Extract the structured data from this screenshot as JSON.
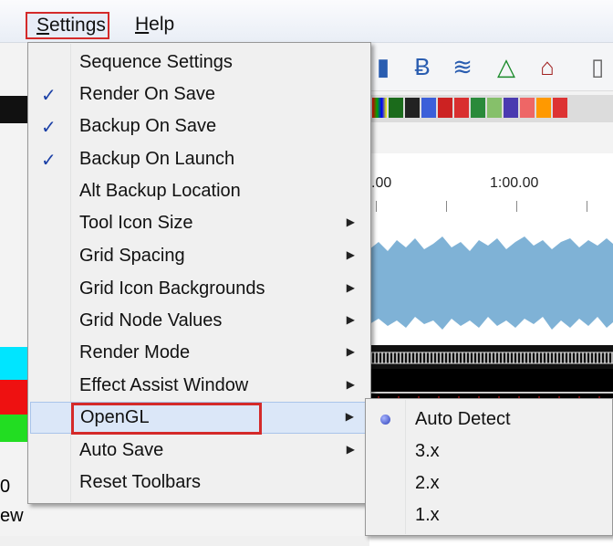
{
  "menubar": {
    "settings": "Settings",
    "help": "Help"
  },
  "background": {
    "ruler": [
      ".00",
      "1:00.00"
    ],
    "left_edge_text": [
      "0",
      "ew"
    ]
  },
  "settings_menu": {
    "items": [
      {
        "label": "Sequence Settings",
        "checked": false,
        "submenu": false
      },
      {
        "label": "Render On Save",
        "checked": true,
        "submenu": false
      },
      {
        "label": "Backup On Save",
        "checked": true,
        "submenu": false
      },
      {
        "label": "Backup On Launch",
        "checked": true,
        "submenu": false
      },
      {
        "label": "Alt Backup Location",
        "checked": false,
        "submenu": false
      },
      {
        "label": "Tool Icon Size",
        "checked": false,
        "submenu": true
      },
      {
        "label": "Grid Spacing",
        "checked": false,
        "submenu": true
      },
      {
        "label": "Grid Icon Backgrounds",
        "checked": false,
        "submenu": true
      },
      {
        "label": "Grid Node Values",
        "checked": false,
        "submenu": true
      },
      {
        "label": "Render Mode",
        "checked": false,
        "submenu": true
      },
      {
        "label": "Effect Assist Window",
        "checked": false,
        "submenu": true
      },
      {
        "label": "OpenGL",
        "checked": false,
        "submenu": true,
        "active": true
      },
      {
        "label": "Auto Save",
        "checked": false,
        "submenu": true
      },
      {
        "label": "Reset Toolbars",
        "checked": false,
        "submenu": false
      }
    ]
  },
  "opengl_submenu": {
    "items": [
      {
        "label": "Auto Detect",
        "selected": true
      },
      {
        "label": "3.x",
        "selected": false
      },
      {
        "label": "2.x",
        "selected": false
      },
      {
        "label": "1.x",
        "selected": false
      }
    ]
  },
  "colors": {
    "highlight_border": "#d42a2a",
    "check": "#1a3fa6",
    "waveform": "#7fb2d6"
  }
}
